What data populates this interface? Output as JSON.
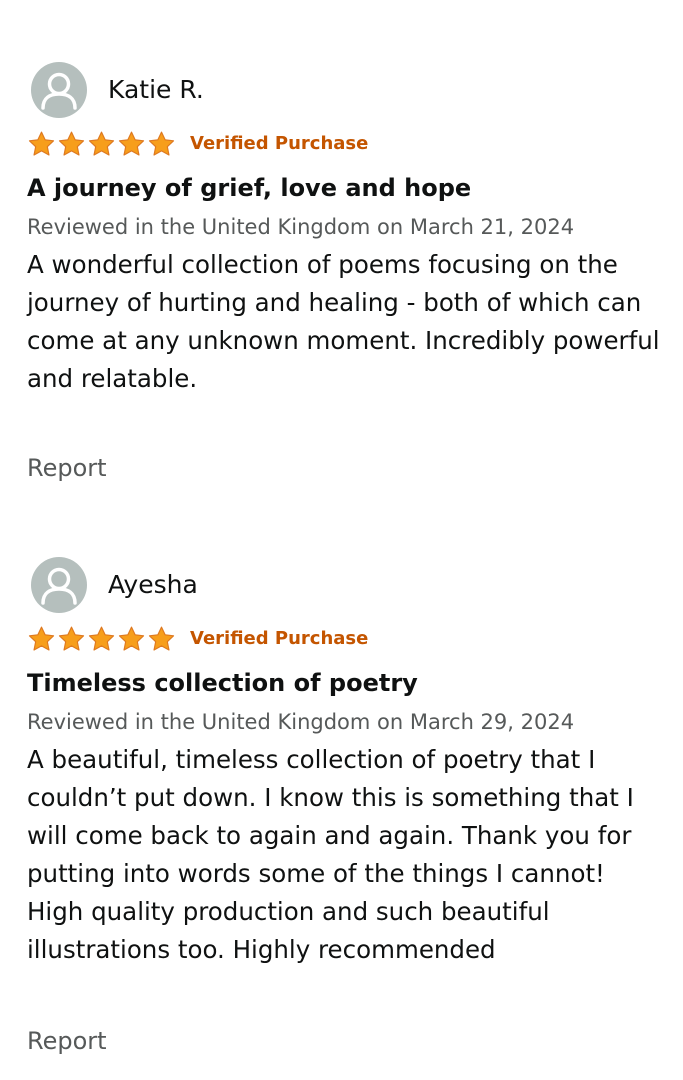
{
  "colors": {
    "star": "#f79e1b",
    "star_stroke": "#de7921",
    "verified": "#c45500",
    "text": "#0f1111",
    "muted": "#565959",
    "avatar_bg": "#b5bfbd"
  },
  "icons": {
    "avatar": "default-user-avatar-icon",
    "star": "filled-star-icon"
  },
  "reviews": [
    {
      "name": "Katie R.",
      "rating": 5,
      "badge": "Verified Purchase",
      "title": "A journey of grief, love and hope",
      "meta": "Reviewed in the United Kingdom on March 21, 2024",
      "body": "A wonderful collection of poems focusing on the journey of hurting and healing - both of which can come at any unknown moment. Incredibly powerful and relatable.",
      "report": "Report"
    },
    {
      "name": "Ayesha",
      "rating": 5,
      "badge": "Verified Purchase",
      "title": "Timeless collection of poetry",
      "meta": "Reviewed in the United Kingdom on March 29, 2024",
      "body": "A beautiful, timeless collection of poetry that I couldn’t put down. I know this is something that I will come back to again and again. Thank you for putting into words some of the things I cannot! High quality production and such beautiful illustrations too. Highly recommended",
      "report": "Report"
    }
  ]
}
